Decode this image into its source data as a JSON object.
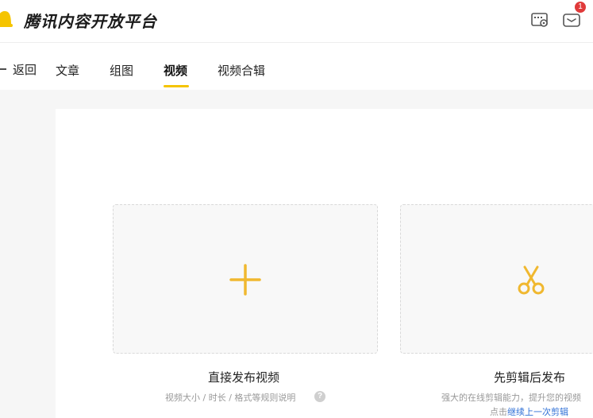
{
  "header": {
    "brand": "腾讯内容开放平台",
    "settings_icon": "settings-icon",
    "message_icon": "mail-icon",
    "message_badge": "1"
  },
  "subnav": {
    "back_label": "返回",
    "tabs": [
      {
        "label": "文章",
        "active": false
      },
      {
        "label": "组图",
        "active": false
      },
      {
        "label": "视频",
        "active": true
      },
      {
        "label": "视频合辑",
        "active": false
      }
    ]
  },
  "options": {
    "direct": {
      "icon": "plus-icon",
      "title": "直接发布视频",
      "note": "视频大小 / 时长 / 格式等规则说明",
      "help": "?"
    },
    "edit": {
      "icon": "scissors-icon",
      "title": "先剪辑后发布",
      "note": "强大的在线剪辑能力，提升您的视频",
      "note2_prefix": "点击",
      "note2_link": "继续上一次剪辑"
    }
  },
  "colors": {
    "accent": "#f5c400",
    "icon_yellow": "#f0b830",
    "link": "#2e6fd6",
    "badge": "#e03a3a"
  }
}
